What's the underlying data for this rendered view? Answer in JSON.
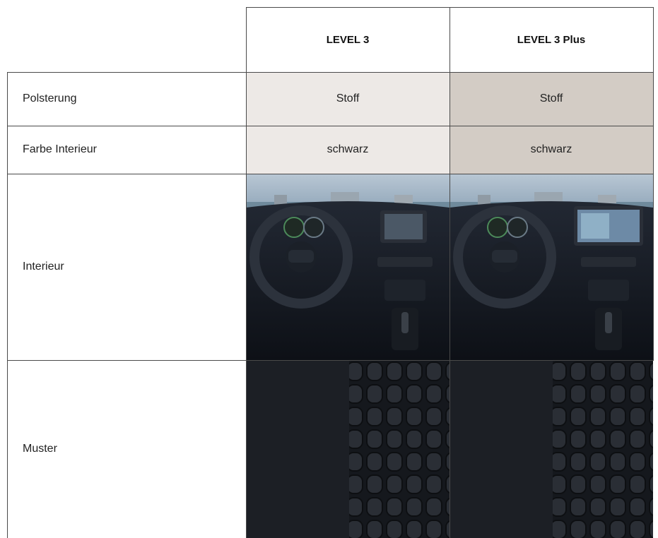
{
  "columns": {
    "col1": "LEVEL 3",
    "col2": "LEVEL 3 Plus"
  },
  "rows": {
    "polsterung": {
      "label": "Polsterung",
      "col1": "Stoff",
      "col2": "Stoff"
    },
    "farbe": {
      "label": "Farbe Interieur",
      "col1": "schwarz",
      "col2": "schwarz"
    },
    "interieur": {
      "label": "Interieur"
    },
    "muster": {
      "label": "Muster"
    }
  },
  "colors": {
    "col1_bg": "#ede9e6",
    "col2_bg": "#d3ccc5",
    "grid_line": "#4a4a4a"
  }
}
